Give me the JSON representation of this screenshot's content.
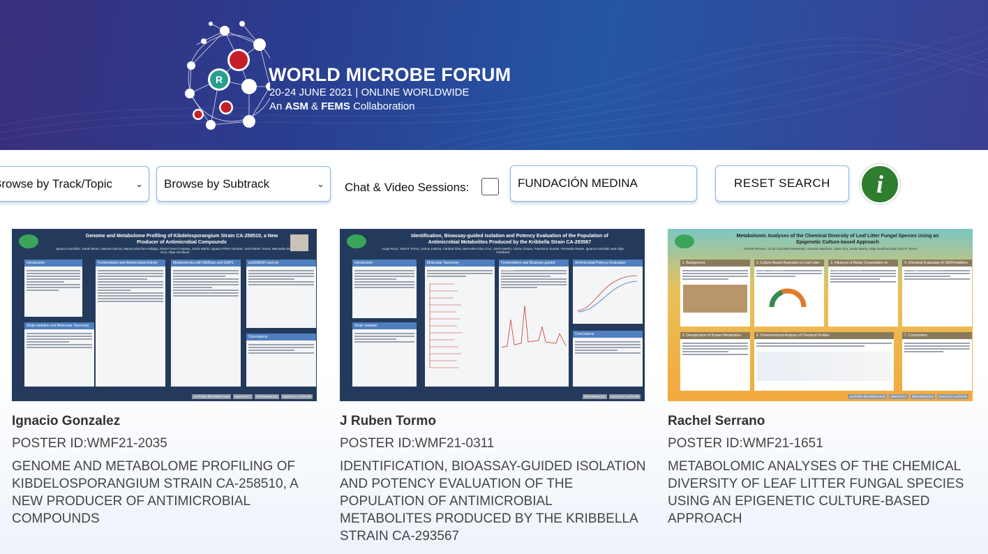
{
  "banner": {
    "title": "WORLD MICROBE FORUM",
    "dates": "20-24 JUNE 2021 | ONLINE WORLDWIDE",
    "collab_prefix": "An",
    "collab_asm": "ASM",
    "collab_amp": "&",
    "collab_fems": "FEMS",
    "collab_suffix": "Collaboration"
  },
  "filters": {
    "track_label": "Browse by Track/Topic",
    "subtrack_label": "Browse by Subtrack",
    "chat_label": "Chat & Video Sessions:",
    "search_value": "FUNDACIÓN MEDINA",
    "reset_label": "RESET SEARCH",
    "info_glyph": "i"
  },
  "posters": [
    {
      "author": "Ignacio Gonzalez",
      "poster_id": "POSTER ID:WMF21-2035",
      "title": "GENOME AND METABOLOME PROFILING OF KIBDELOSPORANGIUM STRAIN CA-258510, A NEW PRODUCER OF ANTIMICROBIAL COMPOUNDS",
      "thumb_title": "Genome and Metabolome Profiling of Kibdelosporangium Strain CA-258510, a New Producer of Antimicrobial Compounds",
      "thumb_authors": "Ignacio González, Sarah Bruns, Manuel García, Marina Sánchez-Hidalgo, Daniel Oves-Costales, Jesús Martín, Ignacio Pérez-Victoria, José Rubén Tormo, Mercedes de la Cruz, Olga Genilloud",
      "thumb_sections": [
        "Introduction",
        "Fermentation and Antimicrobial Activity",
        "Metabolomics with MEBiuto and GNPS",
        "antiSMASH and pls",
        "Strain isolation and Molecular Taxonomy",
        "Conclusions"
      ],
      "footer_tags": [
        "AUTHOR INFORMATION",
        "ABSTRACT",
        "REFERENCES",
        "CONTACT AUTHOR"
      ],
      "bg": "#243a5c"
    },
    {
      "author": "J Ruben Tormo",
      "poster_id": "POSTER ID:WMF21-0311",
      "title": "IDENTIFICATION, BIOASSAY-GUIDED ISOLATION AND POTENCY EVALUATION OF THE POPULATION OF ANTIMICROBIAL METABOLITES PRODUCED BY THE KRIBBELLA STRAIN CA-293567",
      "thumb_title": "Identification, Bioassay-guided Isolation and Potency Evaluation of the Population of Antimicrobial Metabolites Produced by the Kribbella Strain CA-293567",
      "thumb_authors": "Jorge Roca, José R Tormo, Carlos Justicia, Caridad Díaz, Mercedes Díaz-Cruz, Jesús Martín, Gloria Crespo, Francisca Vicente, Fernando Reyes, Ignacio González and Olga Genilloud",
      "thumb_sections": [
        "Introduction",
        "Molecular Taxonomy",
        "Fermentation and Bioassay-guided Isolation",
        "Antimicrobial Potency Evaluation",
        "Strain Isolation",
        "Conclusions"
      ],
      "footer_tags": [
        "REFERENCES",
        "CONTACT AUTHOR"
      ],
      "bg": "#243a5c"
    },
    {
      "author": "Rachel Serrano",
      "poster_id": "POSTER ID:WMF21-1651",
      "title": "METABOLOMIC ANALYSES OF THE CHEMICAL DIVERSITY OF LEAF LITTER FUNGAL SPECIES USING AN EPIGENETIC CULTURE-BASED APPROACH",
      "thumb_title": "Metabolomic Analyses of the Chemical Diversity of Leaf Litter Fungal Species Using an Epigenetic Culture-based Approach",
      "thumb_authors": "Rachel Serrano, Víctor González-Menéndez, Germán Martínez, Clara Toro, Jesús Martín, Olga Genilloud and José R. Tormo",
      "thumb_sections": [
        "1. Background",
        "2. Culture-Based Approach on Leaf Litter Fungal Population",
        "3. Influence of Media Composition on Fungal SM diversity",
        "4. Chemical Evaluation of SAHA Addition on Fungal Fermentations",
        "5. Dereplication of Known Metabolites",
        "6. Chemometrical Analysis of Chemical Profiles",
        "7. Conclusions"
      ],
      "footer_tags": [
        "AUTHOR INFORMATION",
        "ABSTRACT",
        "REFERENCES",
        "CONTACT AUTHOR"
      ],
      "bg": "#e8c15a"
    }
  ]
}
